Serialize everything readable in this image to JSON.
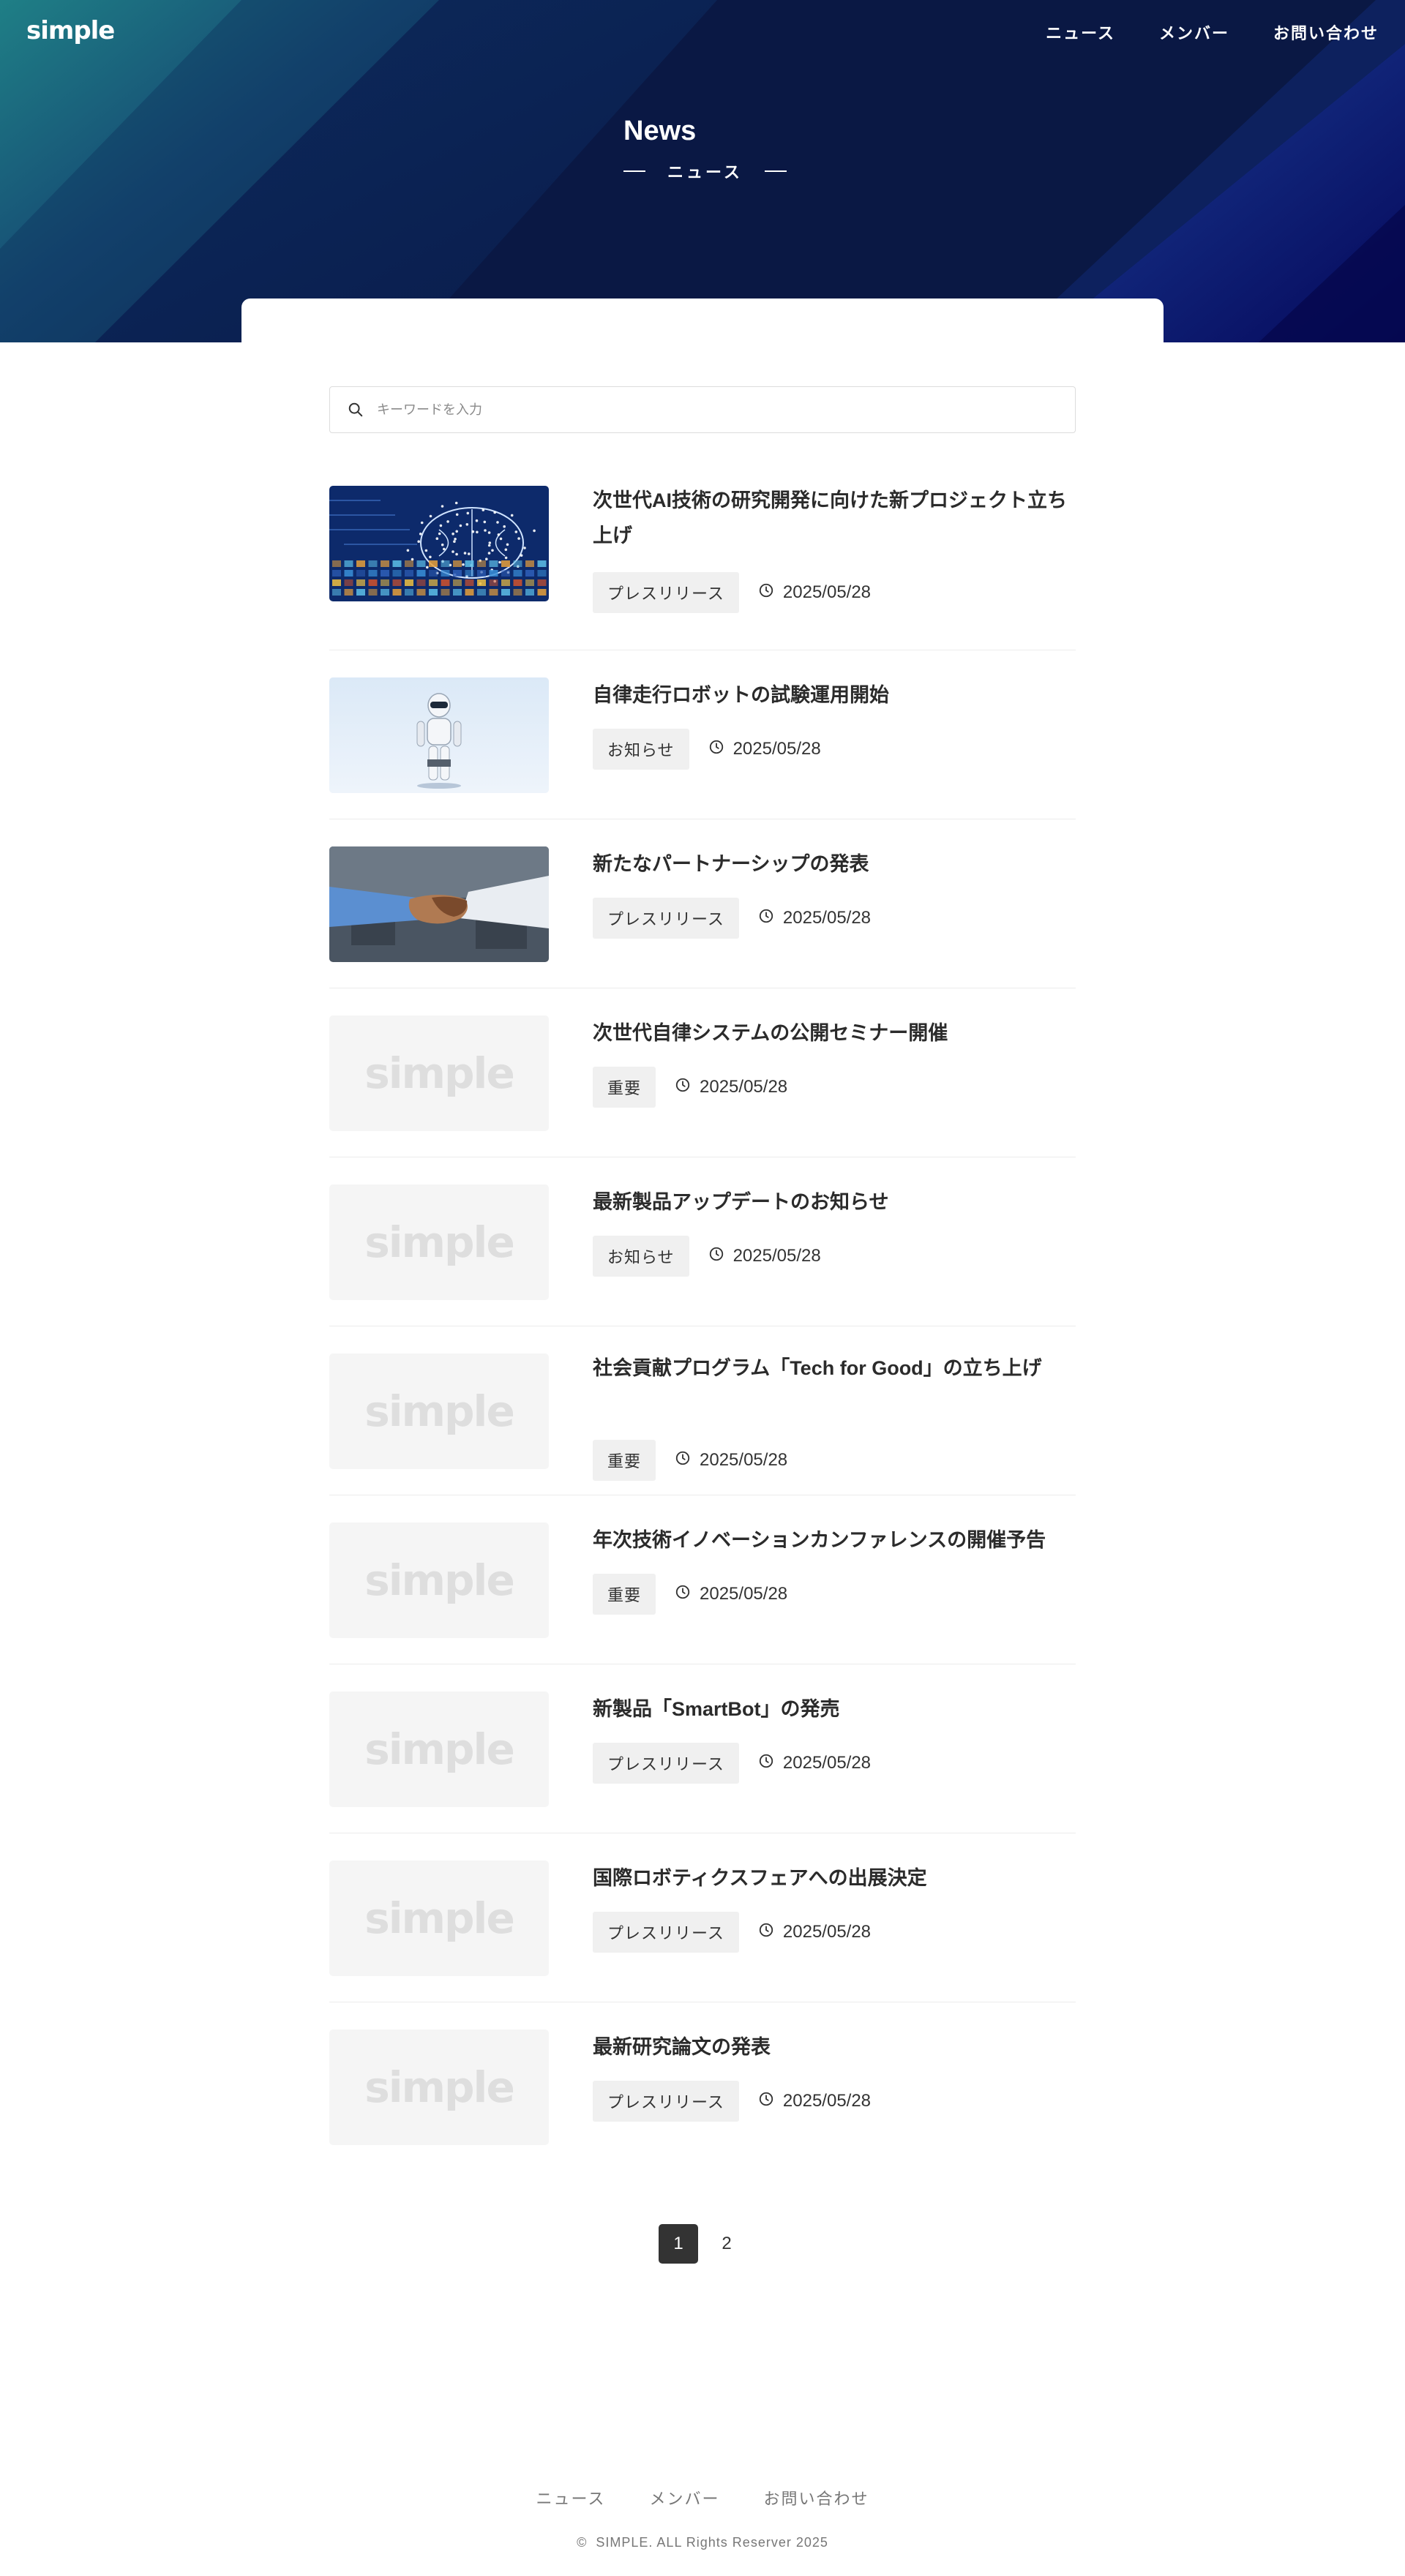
{
  "header": {
    "logo": "simple",
    "nav": [
      "ニュース",
      "メンバー",
      "お問い合わせ"
    ]
  },
  "hero": {
    "title": "News",
    "subtitle": "ニュース"
  },
  "search": {
    "placeholder": "キーワードを入力"
  },
  "news": [
    {
      "title": "次世代AI技術の研究開発に向けた新プロジェクト立ち上げ",
      "tag": "プレスリリース",
      "date": "2025/05/28",
      "image": "ai-brain-image"
    },
    {
      "title": "自律走行ロボットの試験運用開始",
      "tag": "お知らせ",
      "date": "2025/05/28",
      "image": "robot-image"
    },
    {
      "title": "新たなパートナーシップの発表",
      "tag": "プレスリリース",
      "date": "2025/05/28",
      "image": "handshake-image"
    },
    {
      "title": "次世代自律システムの公開セミナー開催",
      "tag": "重要",
      "date": "2025/05/28",
      "image": "placeholder"
    },
    {
      "title": "最新製品アップデートのお知らせ",
      "tag": "お知らせ",
      "date": "2025/05/28",
      "image": "placeholder"
    },
    {
      "title": "社会貢献プログラム「Tech for Good」の立ち上げ",
      "tag": "重要",
      "date": "2025/05/28",
      "image": "placeholder"
    },
    {
      "title": "年次技術イノベーションカンファレンスの開催予告",
      "tag": "重要",
      "date": "2025/05/28",
      "image": "placeholder"
    },
    {
      "title": "新製品「SmartBot」の発売",
      "tag": "プレスリリース",
      "date": "2025/05/28",
      "image": "placeholder"
    },
    {
      "title": "国際ロボティクスフェアへの出展決定",
      "tag": "プレスリリース",
      "date": "2025/05/28",
      "image": "placeholder"
    },
    {
      "title": "最新研究論文の発表",
      "tag": "プレスリリース",
      "date": "2025/05/28",
      "image": "placeholder"
    }
  ],
  "placeholder_logo": "simple",
  "pagination": {
    "pages": [
      "1",
      "2"
    ],
    "current": "1"
  },
  "footer": {
    "nav": [
      "ニュース",
      "メンバー",
      "お問い合わせ"
    ],
    "copyright": "SIMPLE. ALL Rights Reserver 2025"
  },
  "colors": {
    "hero_bg": "#0a1e4a",
    "text": "#333333",
    "tag_bg": "#f0f0f0",
    "active_page": "#333333"
  }
}
